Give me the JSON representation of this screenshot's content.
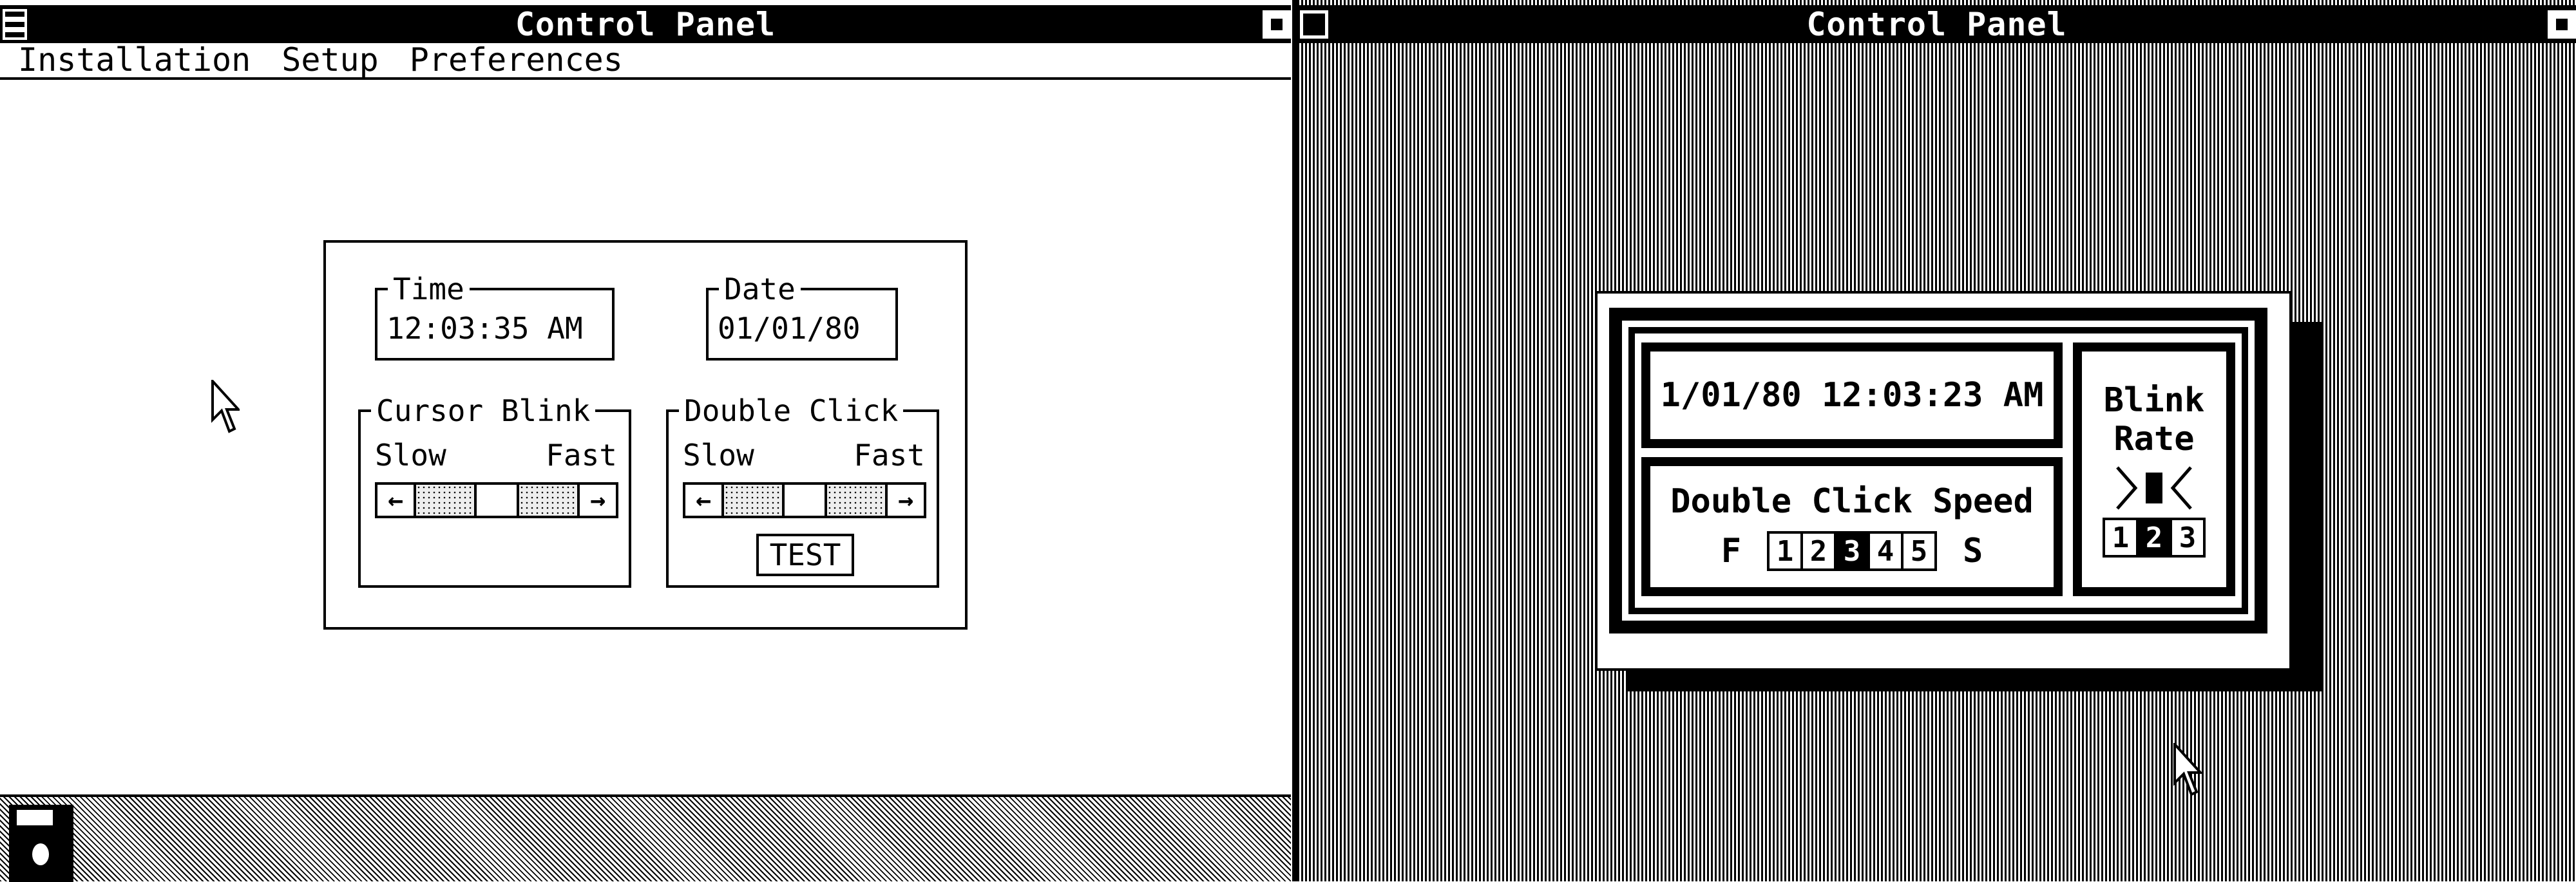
{
  "left_window": {
    "title": "Control Panel",
    "menu": [
      "Installation",
      "Setup",
      "Preferences"
    ],
    "time": {
      "label": "Time",
      "value": "12:03:35 AM"
    },
    "date": {
      "label": "Date",
      "value": "01/01/80"
    },
    "cursor_blink": {
      "label": "Cursor Blink",
      "slow": "Slow",
      "fast": "Fast"
    },
    "double_click": {
      "label": "Double Click",
      "slow": "Slow",
      "fast": "Fast",
      "test_label": "TEST"
    }
  },
  "right_window": {
    "title": "Control Panel",
    "datetime": "1/01/80 12:03:23 AM",
    "double_click_title": "Double Click Speed",
    "fast_label": "F",
    "slow_label": "S",
    "speed_options": [
      "1",
      "2",
      "3",
      "4",
      "5"
    ],
    "speed_selected": "3",
    "blink_title_1": "Blink",
    "blink_title_2": "Rate",
    "blink_options": [
      "1",
      "2",
      "3"
    ],
    "blink_selected": "2"
  },
  "icons": {
    "arrow_left": "←",
    "arrow_right": "→"
  }
}
